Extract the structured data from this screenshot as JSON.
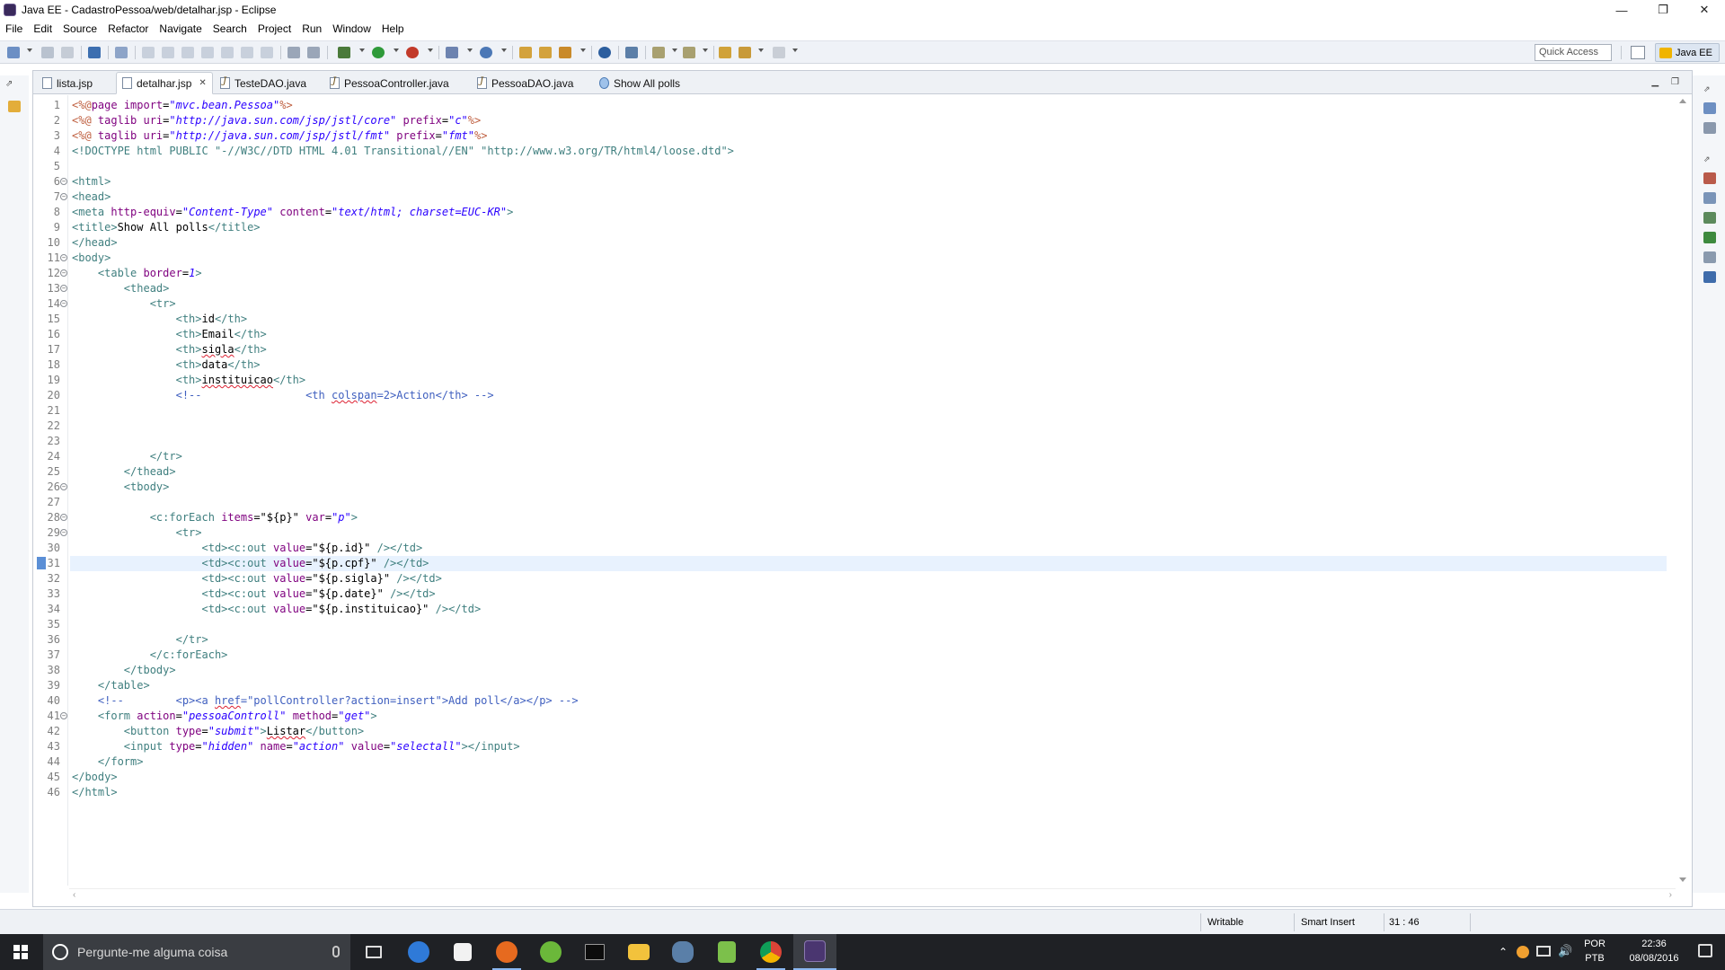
{
  "window": {
    "title": "Java EE - CadastroPessoa/web/detalhar.jsp - Eclipse",
    "controls": [
      "—",
      "❐",
      "✕"
    ]
  },
  "menu": [
    "File",
    "Edit",
    "Source",
    "Refactor",
    "Navigate",
    "Search",
    "Project",
    "Run",
    "Window",
    "Help"
  ],
  "toolbar": {
    "quick_access_placeholder": "Quick Access",
    "perspective_label": "Java EE"
  },
  "tabs": [
    {
      "label": "lista.jsp",
      "icon": "jsp-file-icon",
      "active": false
    },
    {
      "label": "detalhar.jsp",
      "icon": "jsp-file-icon",
      "active": true,
      "close": "✕"
    },
    {
      "label": "TesteDAO.java",
      "icon": "java-file-icon",
      "active": false
    },
    {
      "label": "PessoaController.java",
      "icon": "java-file-icon",
      "active": false
    },
    {
      "label": "PessoaDAO.java",
      "icon": "java-file-icon",
      "active": false
    },
    {
      "label": "Show All polls",
      "icon": "globe-icon",
      "active": false
    }
  ],
  "editor": {
    "current_line": 31,
    "lines": [
      {
        "n": 1,
        "fold": false,
        "segs": [
          [
            "dir",
            "<%@"
          ],
          [
            "attr",
            "page "
          ],
          [
            "attr",
            "import"
          ],
          [
            "plain",
            "="
          ],
          [
            "str",
            "\"mvc.bean.Pessoa\""
          ],
          [
            "dir",
            "%>"
          ]
        ]
      },
      {
        "n": 2,
        "fold": false,
        "segs": [
          [
            "dir",
            "<%@ "
          ],
          [
            "attr",
            "taglib "
          ],
          [
            "attr",
            "uri"
          ],
          [
            "plain",
            "="
          ],
          [
            "str",
            "\"http://java.sun.com/jsp/jstl/core\""
          ],
          [
            "plain",
            " "
          ],
          [
            "attr",
            "prefix"
          ],
          [
            "plain",
            "="
          ],
          [
            "str",
            "\"c\""
          ],
          [
            "dir",
            "%>"
          ]
        ]
      },
      {
        "n": 3,
        "fold": false,
        "segs": [
          [
            "dir",
            "<%@ "
          ],
          [
            "attr",
            "taglib "
          ],
          [
            "attr",
            "uri"
          ],
          [
            "plain",
            "="
          ],
          [
            "str",
            "\"http://java.sun.com/jsp/jstl/fmt\""
          ],
          [
            "plain",
            " "
          ],
          [
            "attr",
            "prefix"
          ],
          [
            "plain",
            "="
          ],
          [
            "str",
            "\"fmt\""
          ],
          [
            "dir",
            "%>"
          ]
        ]
      },
      {
        "n": 4,
        "fold": false,
        "segs": [
          [
            "tag",
            "<!DOCTYPE html PUBLIC \"-//W3C//DTD HTML 4.01 Transitional//EN\" \"http://www.w3.org/TR/html4/loose.dtd\">"
          ]
        ]
      },
      {
        "n": 5,
        "fold": false,
        "segs": []
      },
      {
        "n": 6,
        "fold": true,
        "segs": [
          [
            "tag",
            "<html>"
          ]
        ]
      },
      {
        "n": 7,
        "fold": true,
        "segs": [
          [
            "tag",
            "<head>"
          ]
        ]
      },
      {
        "n": 8,
        "fold": false,
        "segs": [
          [
            "tag",
            "<meta "
          ],
          [
            "attr",
            "http-equiv"
          ],
          [
            "plain",
            "="
          ],
          [
            "str",
            "\"Content-Type\""
          ],
          [
            "plain",
            " "
          ],
          [
            "attr",
            "content"
          ],
          [
            "plain",
            "="
          ],
          [
            "str",
            "\"text/html; charset=EUC-KR\""
          ],
          [
            "tag",
            ">"
          ]
        ]
      },
      {
        "n": 9,
        "fold": false,
        "segs": [
          [
            "tag",
            "<title>"
          ],
          [
            "plain",
            "Show All polls"
          ],
          [
            "tag",
            "</title>"
          ]
        ]
      },
      {
        "n": 10,
        "fold": false,
        "segs": [
          [
            "tag",
            "</head>"
          ]
        ]
      },
      {
        "n": 11,
        "fold": true,
        "segs": [
          [
            "tag",
            "<body>"
          ]
        ]
      },
      {
        "n": 12,
        "fold": true,
        "segs": [
          [
            "plain",
            "    "
          ],
          [
            "tag",
            "<table "
          ],
          [
            "attr",
            "border"
          ],
          [
            "plain",
            "="
          ],
          [
            "str",
            "1"
          ],
          [
            "tag",
            ">"
          ]
        ]
      },
      {
        "n": 13,
        "fold": true,
        "segs": [
          [
            "plain",
            "        "
          ],
          [
            "tag",
            "<thead>"
          ]
        ]
      },
      {
        "n": 14,
        "fold": true,
        "segs": [
          [
            "plain",
            "            "
          ],
          [
            "tag",
            "<tr>"
          ]
        ]
      },
      {
        "n": 15,
        "fold": false,
        "segs": [
          [
            "plain",
            "                "
          ],
          [
            "tag",
            "<th>"
          ],
          [
            "plain",
            "id"
          ],
          [
            "tag",
            "</th>"
          ]
        ]
      },
      {
        "n": 16,
        "fold": false,
        "segs": [
          [
            "plain",
            "                "
          ],
          [
            "tag",
            "<th>"
          ],
          [
            "plain",
            "Email"
          ],
          [
            "tag",
            "</th>"
          ]
        ]
      },
      {
        "n": 17,
        "fold": false,
        "segs": [
          [
            "plain",
            "                "
          ],
          [
            "tag",
            "<th>"
          ],
          [
            "sq",
            "sigla"
          ],
          [
            "tag",
            "</th>"
          ]
        ]
      },
      {
        "n": 18,
        "fold": false,
        "segs": [
          [
            "plain",
            "                "
          ],
          [
            "tag",
            "<th>"
          ],
          [
            "plain",
            "data"
          ],
          [
            "tag",
            "</th>"
          ]
        ]
      },
      {
        "n": 19,
        "fold": false,
        "segs": [
          [
            "plain",
            "                "
          ],
          [
            "tag",
            "<th>"
          ],
          [
            "sq",
            "instituicao"
          ],
          [
            "tag",
            "</th>"
          ]
        ]
      },
      {
        "n": 20,
        "fold": false,
        "segs": [
          [
            "plain",
            "                "
          ],
          [
            "cmt",
            "<!--                <th "
          ],
          [
            "cmtsq",
            "colspan"
          ],
          [
            "cmt",
            "=2>Action</th> -->"
          ]
        ]
      },
      {
        "n": 21,
        "fold": false,
        "segs": []
      },
      {
        "n": 22,
        "fold": false,
        "segs": []
      },
      {
        "n": 23,
        "fold": false,
        "segs": []
      },
      {
        "n": 24,
        "fold": false,
        "segs": [
          [
            "plain",
            "            "
          ],
          [
            "tag",
            "</tr>"
          ]
        ]
      },
      {
        "n": 25,
        "fold": false,
        "segs": [
          [
            "plain",
            "        "
          ],
          [
            "tag",
            "</thead>"
          ]
        ]
      },
      {
        "n": 26,
        "fold": true,
        "segs": [
          [
            "plain",
            "        "
          ],
          [
            "tag",
            "<tbody>"
          ]
        ]
      },
      {
        "n": 27,
        "fold": false,
        "segs": []
      },
      {
        "n": 28,
        "fold": true,
        "segs": [
          [
            "plain",
            "            "
          ],
          [
            "tag",
            "<c:forEach "
          ],
          [
            "attr",
            "items"
          ],
          [
            "plain",
            "="
          ],
          [
            "plainstr",
            "\"${p}\""
          ],
          [
            "plain",
            " "
          ],
          [
            "attr",
            "var"
          ],
          [
            "plain",
            "="
          ],
          [
            "str",
            "\"p\""
          ],
          [
            "tag",
            ">"
          ]
        ]
      },
      {
        "n": 29,
        "fold": true,
        "segs": [
          [
            "plain",
            "                "
          ],
          [
            "tag",
            "<tr>"
          ]
        ]
      },
      {
        "n": 30,
        "fold": false,
        "segs": [
          [
            "plain",
            "                    "
          ],
          [
            "tag",
            "<td><c:out "
          ],
          [
            "attr",
            "value"
          ],
          [
            "plain",
            "="
          ],
          [
            "plainstr",
            "\"${p.id}\""
          ],
          [
            "plain",
            " "
          ],
          [
            "tag",
            "/></td>"
          ]
        ]
      },
      {
        "n": 31,
        "fold": false,
        "segs": [
          [
            "plain",
            "                    "
          ],
          [
            "tag",
            "<td><c:out "
          ],
          [
            "attr",
            "value"
          ],
          [
            "plain",
            "="
          ],
          [
            "plainstr",
            "\"${p.cpf}\""
          ],
          [
            "plain",
            " "
          ],
          [
            "tag",
            "/></td>"
          ]
        ]
      },
      {
        "n": 32,
        "fold": false,
        "segs": [
          [
            "plain",
            "                    "
          ],
          [
            "tag",
            "<td><c:out "
          ],
          [
            "attr",
            "value"
          ],
          [
            "plain",
            "="
          ],
          [
            "plainstr",
            "\"${p.sigla}\""
          ],
          [
            "plain",
            " "
          ],
          [
            "tag",
            "/></td>"
          ]
        ]
      },
      {
        "n": 33,
        "fold": false,
        "segs": [
          [
            "plain",
            "                    "
          ],
          [
            "tag",
            "<td><c:out "
          ],
          [
            "attr",
            "value"
          ],
          [
            "plain",
            "="
          ],
          [
            "plainstr",
            "\"${p.date}\""
          ],
          [
            "plain",
            " "
          ],
          [
            "tag",
            "/></td>"
          ]
        ]
      },
      {
        "n": 34,
        "fold": false,
        "segs": [
          [
            "plain",
            "                    "
          ],
          [
            "tag",
            "<td><c:out "
          ],
          [
            "attr",
            "value"
          ],
          [
            "plain",
            "="
          ],
          [
            "plainstr",
            "\"${p.instituicao}\""
          ],
          [
            "plain",
            " "
          ],
          [
            "tag",
            "/></td>"
          ]
        ]
      },
      {
        "n": 35,
        "fold": false,
        "segs": []
      },
      {
        "n": 36,
        "fold": false,
        "segs": [
          [
            "plain",
            "                "
          ],
          [
            "tag",
            "</tr>"
          ]
        ]
      },
      {
        "n": 37,
        "fold": false,
        "segs": [
          [
            "plain",
            "            "
          ],
          [
            "tag",
            "</c:forEach>"
          ]
        ]
      },
      {
        "n": 38,
        "fold": false,
        "segs": [
          [
            "plain",
            "        "
          ],
          [
            "tag",
            "</tbody>"
          ]
        ]
      },
      {
        "n": 39,
        "fold": false,
        "segs": [
          [
            "plain",
            "    "
          ],
          [
            "tag",
            "</table>"
          ]
        ]
      },
      {
        "n": 40,
        "fold": false,
        "segs": [
          [
            "plain",
            "    "
          ],
          [
            "cmt",
            "<!--        <p><a "
          ],
          [
            "cmtsq",
            "href"
          ],
          [
            "cmt",
            "=\"pollController?action=insert\">Add poll</a></p> -->"
          ]
        ]
      },
      {
        "n": 41,
        "fold": true,
        "segs": [
          [
            "plain",
            "    "
          ],
          [
            "tag",
            "<form "
          ],
          [
            "attr",
            "action"
          ],
          [
            "plain",
            "="
          ],
          [
            "str",
            "\"pessoaControll\""
          ],
          [
            "plain",
            " "
          ],
          [
            "attr",
            "method"
          ],
          [
            "plain",
            "="
          ],
          [
            "str",
            "\"get\""
          ],
          [
            "tag",
            ">"
          ]
        ]
      },
      {
        "n": 42,
        "fold": false,
        "segs": [
          [
            "plain",
            "        "
          ],
          [
            "tag",
            "<button "
          ],
          [
            "attr",
            "type"
          ],
          [
            "plain",
            "="
          ],
          [
            "str",
            "\"submit\""
          ],
          [
            "tag",
            ">"
          ],
          [
            "sq",
            "Listar"
          ],
          [
            "tag",
            "</button>"
          ]
        ]
      },
      {
        "n": 43,
        "fold": false,
        "segs": [
          [
            "plain",
            "        "
          ],
          [
            "tag",
            "<input "
          ],
          [
            "attr",
            "type"
          ],
          [
            "plain",
            "="
          ],
          [
            "str",
            "\"hidden\""
          ],
          [
            "plain",
            " "
          ],
          [
            "attr",
            "name"
          ],
          [
            "plain",
            "="
          ],
          [
            "str",
            "\"action\""
          ],
          [
            "plain",
            " "
          ],
          [
            "attr",
            "value"
          ],
          [
            "plain",
            "="
          ],
          [
            "str",
            "\"selectall\""
          ],
          [
            "tag",
            "></input>"
          ]
        ]
      },
      {
        "n": 44,
        "fold": false,
        "segs": [
          [
            "plain",
            "    "
          ],
          [
            "tag",
            "</form>"
          ]
        ]
      },
      {
        "n": 45,
        "fold": false,
        "segs": [
          [
            "tag",
            "</body>"
          ]
        ]
      },
      {
        "n": 46,
        "fold": false,
        "segs": [
          [
            "tag",
            "</html>"
          ]
        ]
      }
    ]
  },
  "status": {
    "writable": "Writable",
    "insert_mode": "Smart Insert",
    "position": "31 : 46"
  },
  "taskbar": {
    "search_placeholder": "Pergunte-me alguma coisa",
    "lang_top": "POR",
    "lang_bottom": "PTB",
    "time": "22:36",
    "date": "08/08/2016"
  }
}
